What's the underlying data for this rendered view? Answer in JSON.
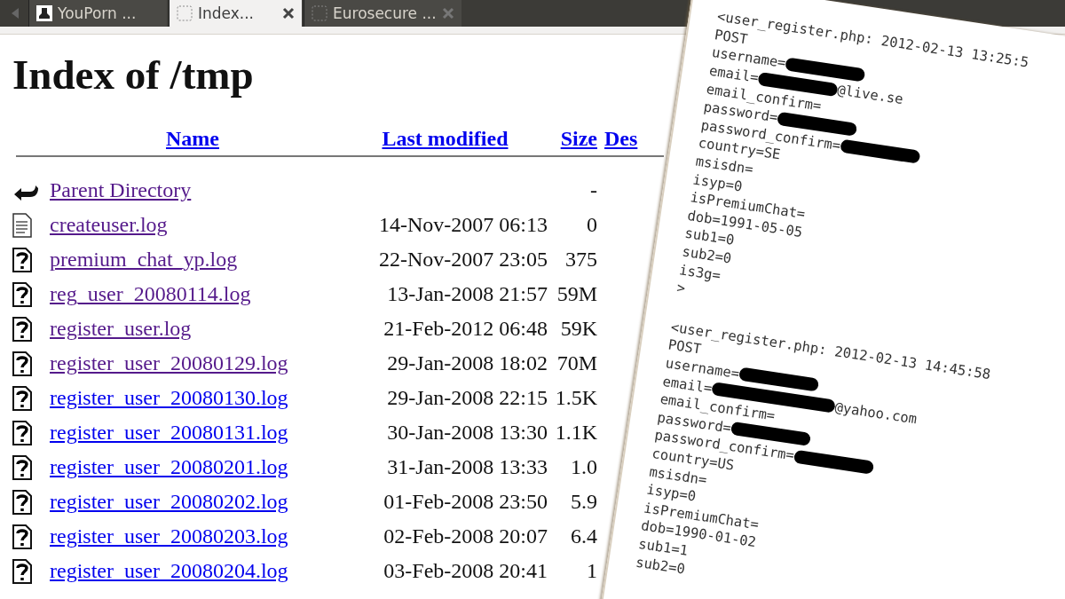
{
  "tabs": [
    {
      "title": "YouPorn ...",
      "closable": false,
      "selected": false
    },
    {
      "title": "Index...",
      "closable": true,
      "selected": true
    },
    {
      "title": "Eurosecure ...",
      "closable": true,
      "selected": false
    }
  ],
  "page": {
    "heading": "Index of /tmp",
    "columns": [
      "Name",
      "Last modified",
      "Size",
      "Des"
    ],
    "rows": [
      {
        "kind": "parent",
        "name": "Parent Directory",
        "modified": "",
        "size": "-",
        "visited": true
      },
      {
        "kind": "text",
        "name": "createuser.log",
        "modified": "14-Nov-2007 06:13",
        "size": "0",
        "visited": true
      },
      {
        "kind": "unknown",
        "name": "premium_chat_yp.log",
        "modified": "22-Nov-2007 23:05",
        "size": "375",
        "visited": true
      },
      {
        "kind": "unknown",
        "name": "reg_user_20080114.log",
        "modified": "13-Jan-2008 21:57",
        "size": "59M",
        "visited": true
      },
      {
        "kind": "unknown",
        "name": "register_user.log",
        "modified": "21-Feb-2012 06:48",
        "size": "59K",
        "visited": true
      },
      {
        "kind": "unknown",
        "name": "register_user_20080129.log",
        "modified": "29-Jan-2008 18:02",
        "size": "70M",
        "visited": true
      },
      {
        "kind": "unknown",
        "name": "register_user_20080130.log",
        "modified": "29-Jan-2008 22:15",
        "size": "1.5K",
        "visited": false
      },
      {
        "kind": "unknown",
        "name": "register_user_20080131.log",
        "modified": "30-Jan-2008 13:30",
        "size": "1.1K",
        "visited": false
      },
      {
        "kind": "unknown",
        "name": "register_user_20080201.log",
        "modified": "31-Jan-2008 13:33",
        "size": "1.0",
        "visited": false
      },
      {
        "kind": "unknown",
        "name": "register_user_20080202.log",
        "modified": "01-Feb-2008 23:50",
        "size": "5.9",
        "visited": false
      },
      {
        "kind": "unknown",
        "name": "register_user_20080203.log",
        "modified": "02-Feb-2008 20:07",
        "size": "6.4",
        "visited": false
      },
      {
        "kind": "unknown",
        "name": "register_user_20080204.log",
        "modified": "03-Feb-2008 20:41",
        "size": "1",
        "visited": false
      }
    ]
  },
  "log": {
    "entries": [
      {
        "lines": [
          {
            "text": "<user_register.php: 2012-02-13 13:25:5"
          },
          {
            "text": "POST"
          },
          {
            "text": "username=",
            "redacted": true
          },
          {
            "text": "email=",
            "redacted": true,
            "after": "@live.se"
          },
          {
            "text": "email_confirm="
          },
          {
            "text": "password=",
            "redacted": true
          },
          {
            "text": "password_confirm=",
            "redacted": true
          },
          {
            "text": "country=SE"
          },
          {
            "text": "msisdn="
          },
          {
            "text": "isyp=0"
          },
          {
            "text": "isPremiumChat="
          },
          {
            "text": "dob=1991-05-05"
          },
          {
            "text": "sub1=0"
          },
          {
            "text": "sub2=0"
          },
          {
            "text": "is3g="
          },
          {
            "text": ">"
          }
        ]
      },
      {
        "lines": [
          {
            "text": "<user_register.php: 2012-02-13 14:45:58"
          },
          {
            "text": "POST"
          },
          {
            "text": "username=",
            "redacted": true
          },
          {
            "text": "email=",
            "redacted": true,
            "after": "@yahoo.com"
          },
          {
            "text": "email_confirm="
          },
          {
            "text": "password=",
            "redacted": true
          },
          {
            "text": "password_confirm=",
            "redacted": true
          },
          {
            "text": "country=US"
          },
          {
            "text": "msisdn="
          },
          {
            "text": "isyp=0"
          },
          {
            "text": "isPremiumChat="
          },
          {
            "text": "dob=1990-01-02"
          },
          {
            "text": "sub1=1"
          },
          {
            "text": "sub2=0"
          }
        ]
      }
    ]
  }
}
